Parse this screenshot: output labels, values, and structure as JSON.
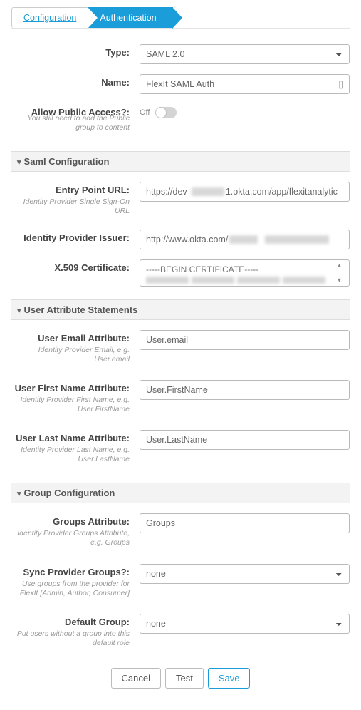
{
  "tabs": {
    "config": "Configuration",
    "auth": "Authentication"
  },
  "type": {
    "label": "Type:",
    "value": "SAML 2.0"
  },
  "name": {
    "label": "Name:",
    "value": "FlexIt SAML Auth"
  },
  "publicAccess": {
    "label": "Allow Public Access?:",
    "hint": "You still need to add the Public group to content",
    "state": "Off"
  },
  "sections": {
    "saml": "Saml Configuration",
    "userAttr": "User Attribute Statements",
    "groupConf": "Group Configuration"
  },
  "saml": {
    "entry": {
      "label": "Entry Point URL:",
      "hint": "Identity Provider Single Sign-On URL",
      "prefix": "https://dev-",
      "suffix": "1.okta.com/app/flexitanalytic"
    },
    "issuer": {
      "label": "Identity Provider Issuer:",
      "prefix": "http://www.okta.com/"
    },
    "cert": {
      "label": "X.509 Certificate:",
      "value": "-----BEGIN CERTIFICATE-----"
    }
  },
  "userAttr": {
    "email": {
      "label": "User Email Attribute:",
      "hint": "Identity Provider Email, e.g. User.email",
      "value": "User.email"
    },
    "first": {
      "label": "User First Name Attribute:",
      "hint": "Identity Provider First Name, e.g. User.FirstName",
      "value": "User.FirstName"
    },
    "last": {
      "label": "User Last Name Attribute:",
      "hint": "Identity Provider Last Name, e.g. User.LastName",
      "value": "User.LastName"
    }
  },
  "groupConf": {
    "attr": {
      "label": "Groups Attribute:",
      "hint": "Identity Provider Groups Attribute, e.g. Groups",
      "value": "Groups"
    },
    "sync": {
      "label": "Sync Provider Groups?:",
      "hint": "Use groups from the provider for FlexIt [Admin, Author, Consumer]",
      "value": "none"
    },
    "def": {
      "label": "Default Group:",
      "hint": "Put users without a group into this default role",
      "value": "none"
    }
  },
  "buttons": {
    "cancel": "Cancel",
    "test": "Test",
    "save": "Save"
  }
}
